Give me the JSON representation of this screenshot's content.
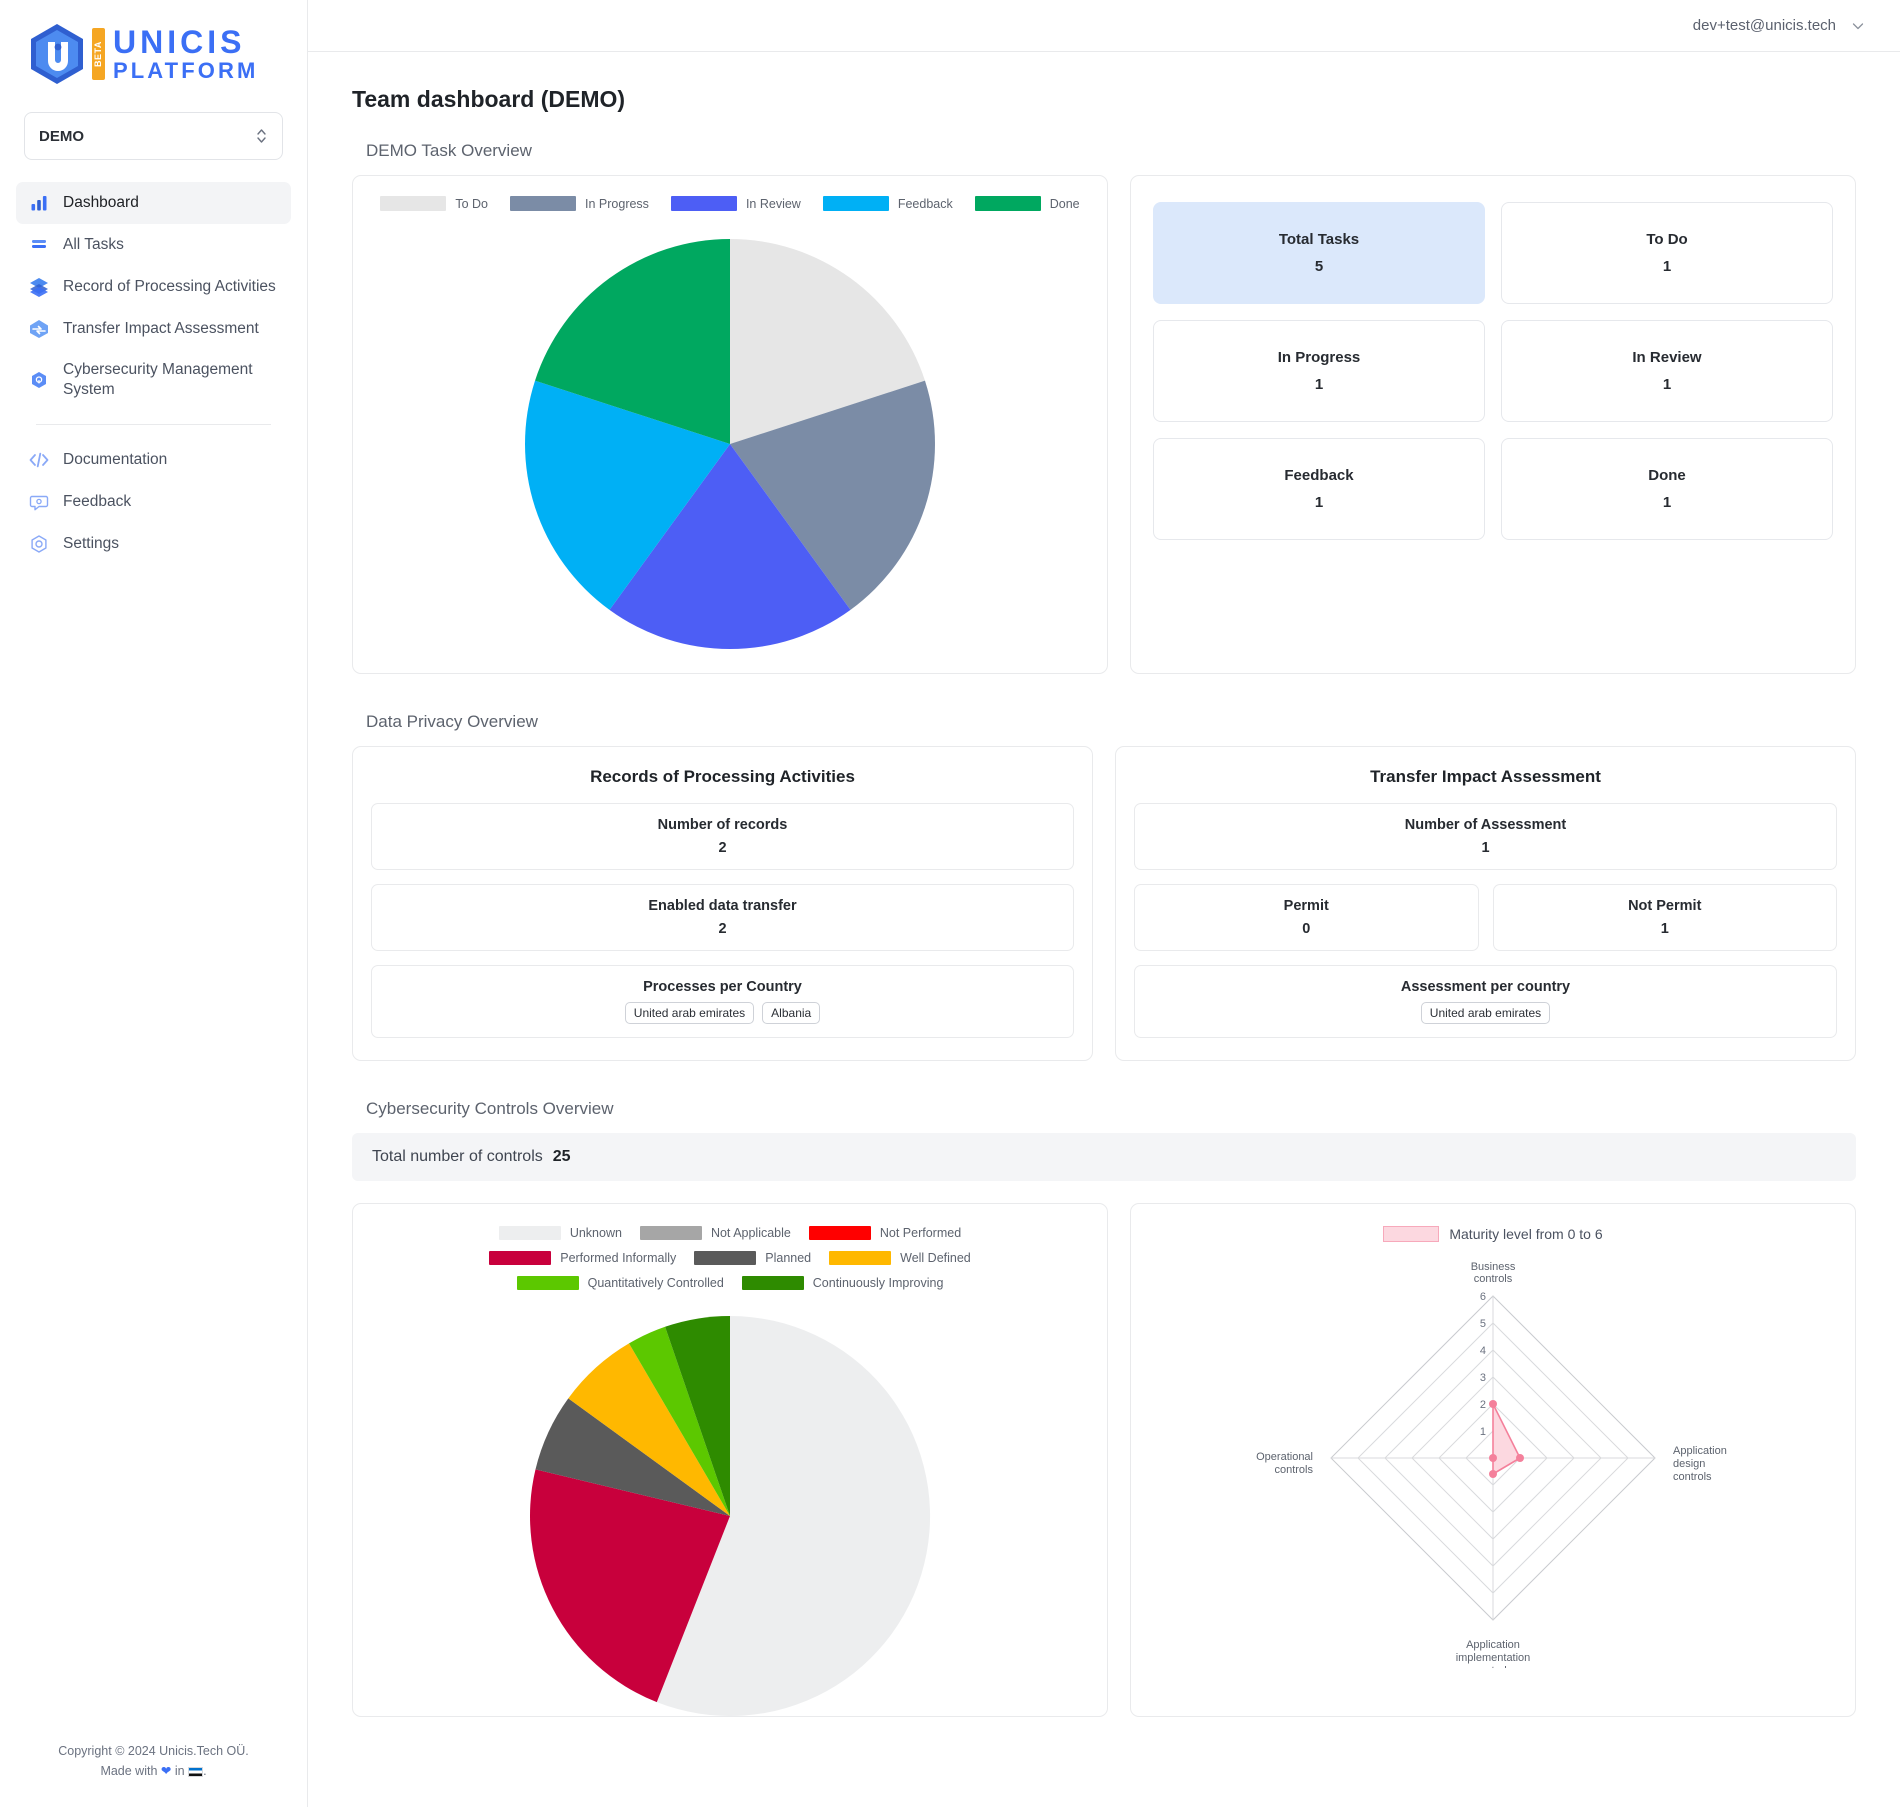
{
  "brand": {
    "name_line1": "UNICIS",
    "name_line2": "PLATFORM",
    "badge": "BETA",
    "logo_icon": "unicis-hexagon-logo",
    "color": "#3B6FF5",
    "badge_color": "#F5A623"
  },
  "sidebar": {
    "team_selector": {
      "value": "DEMO",
      "icon": "updown-chevron-icon"
    },
    "items": [
      {
        "label": "Dashboard",
        "icon": "bar-chart-icon",
        "active": true
      },
      {
        "label": "All Tasks",
        "icon": "list-icon",
        "active": false
      },
      {
        "label": "Record of Processing Activities",
        "icon": "layers-icon",
        "active": false
      },
      {
        "label": "Transfer Impact Assessment",
        "icon": "transfer-icon",
        "active": false
      },
      {
        "label": "Cybersecurity Management System",
        "icon": "shield-lock-icon",
        "active": false
      }
    ],
    "secondary_items": [
      {
        "label": "Documentation",
        "icon": "code-icon"
      },
      {
        "label": "Feedback",
        "icon": "chat-bubble-icon"
      },
      {
        "label": "Settings",
        "icon": "gear-icon"
      }
    ],
    "footer": {
      "line1": "Copyright © 2024 Unicis.Tech OÜ.",
      "made_with_prefix": "Made with ",
      "heart_icon": "heart-icon",
      "made_with_middle": " in ",
      "flag_icon": "estonia-flag-icon",
      "made_with_suffix": "."
    }
  },
  "topbar": {
    "user_email": "dev+test@unicis.tech",
    "chevron_icon": "chevron-down-icon"
  },
  "page": {
    "title": "Team dashboard (DEMO)",
    "sections": {
      "task_overview": "DEMO Task Overview",
      "data_privacy": "Data Privacy Overview",
      "cybersecurity": "Cybersecurity Controls Overview"
    }
  },
  "task_stats": [
    {
      "label": "Total Tasks",
      "value": "5",
      "highlight": true
    },
    {
      "label": "To Do",
      "value": "1",
      "highlight": false
    },
    {
      "label": "In Progress",
      "value": "1",
      "highlight": false
    },
    {
      "label": "In Review",
      "value": "1",
      "highlight": false
    },
    {
      "label": "Feedback",
      "value": "1",
      "highlight": false
    },
    {
      "label": "Done",
      "value": "1",
      "highlight": false
    }
  ],
  "data_privacy": {
    "ropa": {
      "title": "Records of Processing Activities",
      "number_of_records": {
        "label": "Number of records",
        "value": "2"
      },
      "enabled_data_transfer": {
        "label": "Enabled data transfer",
        "value": "2"
      },
      "processes_per_country": {
        "label": "Processes per Country",
        "countries": [
          "United arab emirates",
          "Albania"
        ]
      }
    },
    "tia": {
      "title": "Transfer Impact Assessment",
      "number_of_assessment": {
        "label": "Number of Assessment",
        "value": "1"
      },
      "permit": {
        "label": "Permit",
        "value": "0"
      },
      "not_permit": {
        "label": "Not Permit",
        "value": "1"
      },
      "assessment_per_country": {
        "label": "Assessment per country",
        "countries": [
          "United arab emirates"
        ]
      }
    }
  },
  "cybersecurity": {
    "total_controls_label": "Total number of controls",
    "total_controls_value": "25"
  },
  "chart_data": [
    {
      "type": "pie",
      "title": "DEMO Task Overview",
      "legend_position": "top",
      "categories": [
        "To Do",
        "In Progress",
        "In Review",
        "Feedback",
        "Done"
      ],
      "values": [
        1,
        1,
        1,
        1,
        1
      ],
      "colors": [
        "#E6E6E6",
        "#7B8CA6",
        "#4D5EF5",
        "#00B0F5",
        "#00A860"
      ],
      "total": 5
    },
    {
      "type": "pie",
      "title": "Cybersecurity Controls Overview",
      "legend_position": "top",
      "categories": [
        "Unknown",
        "Not Applicable",
        "Not Performed",
        "Performed Informally",
        "Planned",
        "Well Defined",
        "Quantitatively Controlled",
        "Continuously Improving"
      ],
      "values": [
        14,
        0,
        0,
        5,
        2,
        2,
        1,
        1
      ],
      "colors": [
        "#EDEEEF",
        "#A6A6A6",
        "#FF0000",
        "#C8003C",
        "#5A5A5A",
        "#FFB800",
        "#5CC800",
        "#2E8B00"
      ],
      "total": 25
    },
    {
      "type": "radar",
      "title": "Maturity level from 0 to 6",
      "legend": [
        "Maturity level from 0 to 6"
      ],
      "axes": [
        "Business controls",
        "Application design controls",
        "Application implementation controls",
        "Operational controls"
      ],
      "values": [
        2,
        1,
        0.6,
        0
      ],
      "tick_labels": [
        "6",
        "5",
        "4",
        "3",
        "2",
        "1"
      ],
      "rlim": [
        0,
        6
      ],
      "fill_color": "#FCD8E0",
      "line_color": "#F4809B"
    }
  ]
}
